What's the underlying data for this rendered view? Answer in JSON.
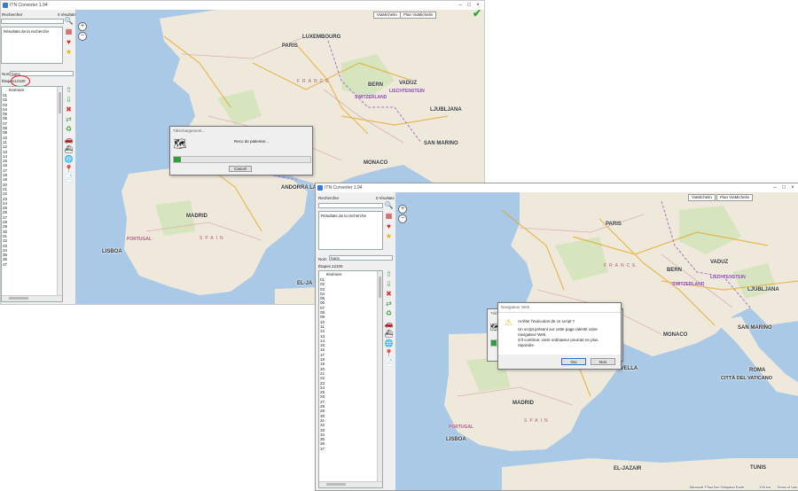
{
  "windows": {
    "back": {
      "title": "ITN Converter 1.94",
      "ctl_min": "–",
      "ctl_max": "□",
      "ctl_close": "×",
      "search_label": "Rechercher",
      "results_label": "0 résultats",
      "results_placeholder": "Résultats de la recherche",
      "name_label": "Nom",
      "name_value": "hans",
      "steps_label": "Étapes",
      "steps_value": "12100",
      "itinerary_header": "Itinéraire",
      "rows": [
        "01",
        "02",
        "03",
        "04",
        "05",
        "06",
        "07",
        "08",
        "09",
        "10",
        "11",
        "12",
        "13",
        "14",
        "15",
        "16",
        "17",
        "18",
        "19",
        "20",
        "21",
        "22",
        "23",
        "24",
        "25",
        "26",
        "27",
        "28",
        "29",
        "30",
        "31",
        "32",
        "33",
        "34",
        "35",
        "36",
        "37"
      ],
      "map_tab_1": "ViaMichelin",
      "map_tab_2": "Plan ViaMichelin",
      "dialog": {
        "title": "Téléchargement...",
        "message": "Reco de patienter...",
        "progress": 0.05,
        "cancel": "Cancel"
      }
    },
    "front": {
      "title": "ITN Converter 1.94",
      "ctl_min": "–",
      "ctl_max": "□",
      "ctl_close": "×",
      "search_label": "Rechercher",
      "results_label": "0 résultats",
      "results_placeholder": "Résultats de la recherche",
      "name_label": "Nom",
      "name_value": "hans",
      "steps_label": "Étapes :",
      "steps_value": "12100",
      "itinerary_header": "Itinéraire",
      "rows": [
        "01",
        "02",
        "03",
        "04",
        "05",
        "06",
        "07",
        "08",
        "09",
        "10",
        "11",
        "12",
        "13",
        "14",
        "15",
        "16",
        "17",
        "18",
        "19",
        "20",
        "21",
        "22",
        "23",
        "24",
        "25",
        "26",
        "27",
        "28",
        "29",
        "30",
        "31",
        "32",
        "33",
        "34",
        "35",
        "36",
        "37"
      ],
      "map_tab_1": "ViaMichelin",
      "map_tab_2": "Plan ViaMichelin",
      "attribution": "Microsoft ©TomTom ©Mapbox Earth",
      "scale": "100 km",
      "terms": "Terms of Use",
      "bg_dialog_title": "Télé",
      "script_dialog": {
        "title": "Navigateur Web",
        "question": "Arrêter l'exécution de ce script ?",
        "body1": "Un script présent sur cette page ralentit votre navigateur Web.",
        "body2": "S'il continue, votre ordinateur pourrait ne plus répondre.",
        "yes": "Oui",
        "no": "Non"
      }
    }
  },
  "map_labels": {
    "back": {
      "cities": [
        "LUXEMBOURG",
        "PARIS",
        "BERN",
        "VADUZ",
        "LJUBLJANA",
        "SAN MARINO",
        "MONACO",
        "ANDORRA LA VELLA",
        "MADRID",
        "LISBOA",
        "EL-JA"
      ],
      "countries": [
        "FRANCE",
        "SPAIN",
        "PORTUGAL",
        "SWITZERLAND",
        "LIECHTENSTEIN"
      ]
    },
    "front": {
      "cities": [
        "PARIS",
        "BERN",
        "VADUZ",
        "LJUBLJANA",
        "MONACO",
        "SAN MARINO",
        "ROMA",
        "CITTÀ DEL VATICANO",
        "ANDORRA LA VELLA",
        "MADRID",
        "LISBOA",
        "EL-JAZAIR",
        "TUNIS"
      ],
      "countries": [
        "FRANCE",
        "SPAIN",
        "PORTUGAL",
        "SWITZERLAND",
        "LIECHTENSTEIN"
      ]
    }
  },
  "colors": {
    "sea": "#a9c9e6",
    "land": "#efe9dc",
    "green_area": "#cfe3b7",
    "border": "#b06ec0",
    "progress": "#2e9e3e",
    "annotation": "#e0141c"
  }
}
